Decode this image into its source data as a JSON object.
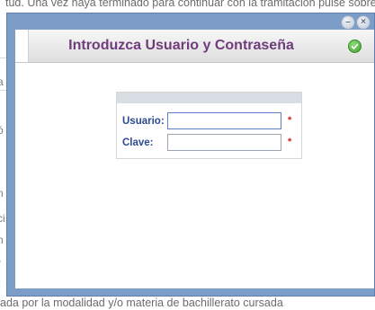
{
  "background": {
    "top_text": "tud. Una vez haya terminado para continuar con la tramitación pulse sobre",
    "bottom_text": "ada por la modalidad y/o materia de bachillerato cursada",
    "left_fragments": [
      "a",
      "ó",
      "i",
      "n",
      "ci",
      "n",
      "r",
      "t"
    ]
  },
  "dialog": {
    "title": "Introduzca Usuario y Contraseña",
    "title_color": "#6f3c7c",
    "frame_color": "#7d9dc9",
    "icons": {
      "minimize": "minimize-icon",
      "close": "close-icon",
      "confirm": "check-circle-icon"
    },
    "minimize_glyph": "–",
    "close_glyph": "×"
  },
  "login": {
    "user_label": "Usuario:",
    "user_value": "",
    "password_label": "Clave:",
    "password_value": "",
    "required_mark": "*",
    "label_color": "#2c4b8f",
    "required_color": "#cc2222"
  }
}
